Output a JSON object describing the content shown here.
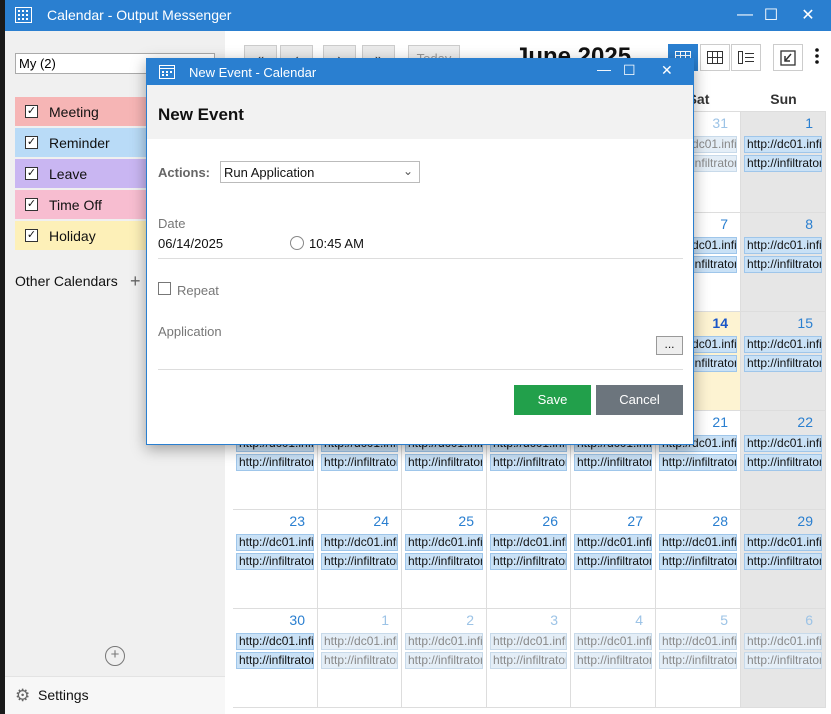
{
  "window": {
    "title": "Calendar - Output Messenger",
    "minimize": "—",
    "maximize": "☐",
    "close": "✕"
  },
  "sidebar": {
    "calendar_select": "My (2)",
    "calendars": [
      {
        "label": "Meeting",
        "color": "#f6b5b5",
        "checked": true
      },
      {
        "label": "Reminder",
        "color": "#b9dbf7",
        "checked": true
      },
      {
        "label": "Leave",
        "color": "#c9b6f2",
        "checked": true
      },
      {
        "label": "Time Off",
        "color": "#f7bdd0",
        "checked": true
      },
      {
        "label": "Holiday",
        "color": "#fdf0b8",
        "checked": true
      }
    ],
    "other_calendars": "Other Calendars",
    "settings": "Settings"
  },
  "toolbar": {
    "first": "«",
    "prev": "‹",
    "next": "›",
    "last": "»",
    "today": "Today",
    "month_title": "June 2025"
  },
  "calendar": {
    "days_of_week": [
      "Sat",
      "Sun"
    ],
    "event_line_1": "http://dc01.infi",
    "event_line_2": "http://infiltrator",
    "rows": [
      {
        "cells": [
          {
            "day": "",
            "other": false
          },
          {
            "day": "",
            "other": false
          },
          {
            "day": "",
            "other": false
          },
          {
            "day": "",
            "other": false
          },
          {
            "day": "",
            "other": false
          },
          {
            "day": "31",
            "other": true
          },
          {
            "day": "1",
            "other": false
          }
        ]
      },
      {
        "cells": [
          {
            "day": "",
            "other": false
          },
          {
            "day": "",
            "other": false
          },
          {
            "day": "",
            "other": false
          },
          {
            "day": "",
            "other": false
          },
          {
            "day": "",
            "other": false
          },
          {
            "day": "7",
            "other": false
          },
          {
            "day": "8",
            "other": false
          }
        ]
      },
      {
        "cells": [
          {
            "day": "",
            "other": false
          },
          {
            "day": "",
            "other": false
          },
          {
            "day": "",
            "other": false
          },
          {
            "day": "",
            "other": false
          },
          {
            "day": "",
            "other": false
          },
          {
            "day": "14",
            "other": false,
            "today": true
          },
          {
            "day": "15",
            "other": false
          }
        ]
      },
      {
        "cells": [
          {
            "day": "",
            "other": false
          },
          {
            "day": "",
            "other": false
          },
          {
            "day": "",
            "other": false
          },
          {
            "day": "",
            "other": false
          },
          {
            "day": "",
            "other": false
          },
          {
            "day": "21",
            "other": false
          },
          {
            "day": "22",
            "other": false
          }
        ]
      },
      {
        "cells": [
          {
            "day": "23",
            "other": false
          },
          {
            "day": "24",
            "other": false
          },
          {
            "day": "25",
            "other": false
          },
          {
            "day": "26",
            "other": false
          },
          {
            "day": "27",
            "other": false
          },
          {
            "day": "28",
            "other": false
          },
          {
            "day": "29",
            "other": false
          }
        ]
      },
      {
        "cells": [
          {
            "day": "30",
            "other": false
          },
          {
            "day": "1",
            "other": true
          },
          {
            "day": "2",
            "other": true
          },
          {
            "day": "3",
            "other": true
          },
          {
            "day": "4",
            "other": true
          },
          {
            "day": "5",
            "other": true
          },
          {
            "day": "6",
            "other": true
          }
        ]
      }
    ]
  },
  "dialog": {
    "title": "New Event - Calendar",
    "heading": "New Event",
    "actions_label": "Actions:",
    "actions_value": "Run Application",
    "date_label": "Date",
    "date_value": "06/14/2025",
    "time_value": "10:45 AM",
    "repeat_label": "Repeat",
    "application_label": "Application",
    "browse": "...",
    "save": "Save",
    "cancel": "Cancel"
  }
}
